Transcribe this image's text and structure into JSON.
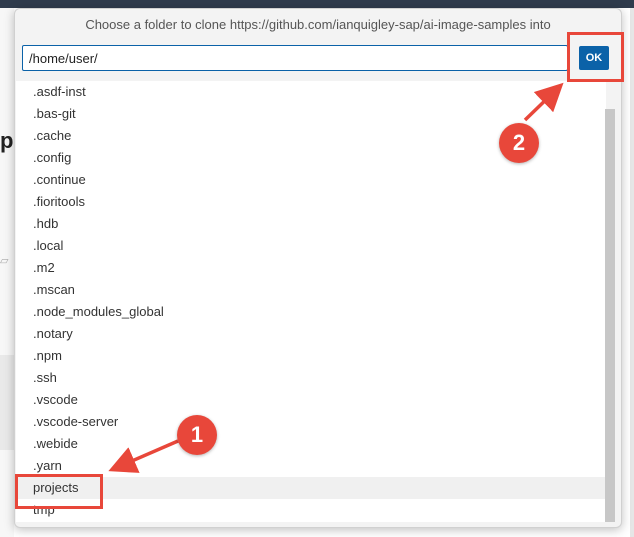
{
  "dialog": {
    "title": "Choose a folder to clone https://github.com/ianquigley-sap/ai-image-samples into",
    "path_value": "/home/user/",
    "ok_label": "OK",
    "folders": [
      ".asdf-inst",
      ".bas-git",
      ".cache",
      ".config",
      ".continue",
      ".fioritools",
      ".hdb",
      ".local",
      ".m2",
      ".mscan",
      ".node_modules_global",
      ".notary",
      ".npm",
      ".ssh",
      ".vscode",
      ".vscode-server",
      ".webide",
      ".yarn",
      "projects",
      "tmp"
    ],
    "highlighted_folder": "projects"
  },
  "annotations": {
    "badge_1": "1",
    "badge_2": "2",
    "color": "#e8473a"
  },
  "background": {
    "partial_heading": "p"
  }
}
